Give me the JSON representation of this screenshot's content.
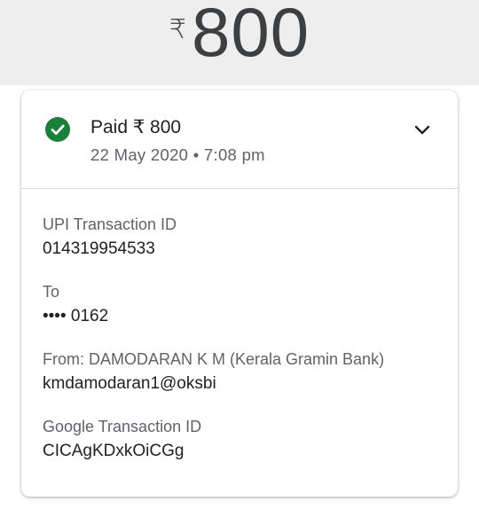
{
  "header": {
    "currency_symbol": "₹",
    "amount": "800"
  },
  "summary": {
    "status_text": "Paid ₹ 800",
    "date_time": "22 May 2020 • 7:08 pm",
    "status_color": "#188038"
  },
  "details": {
    "upi": {
      "label": "UPI Transaction ID",
      "value": "014319954533"
    },
    "to": {
      "label": "To",
      "value": "•••• 0162"
    },
    "from": {
      "label": "From: DAMODARAN  K M (Kerala Gramin Bank)",
      "value": "kmdamodaran1@oksbi"
    },
    "google": {
      "label": "Google Transaction ID",
      "value": "CICAgKDxkOiCGg"
    }
  },
  "icons": {
    "status": "check-circle-icon",
    "expand": "chevron-down-icon"
  }
}
